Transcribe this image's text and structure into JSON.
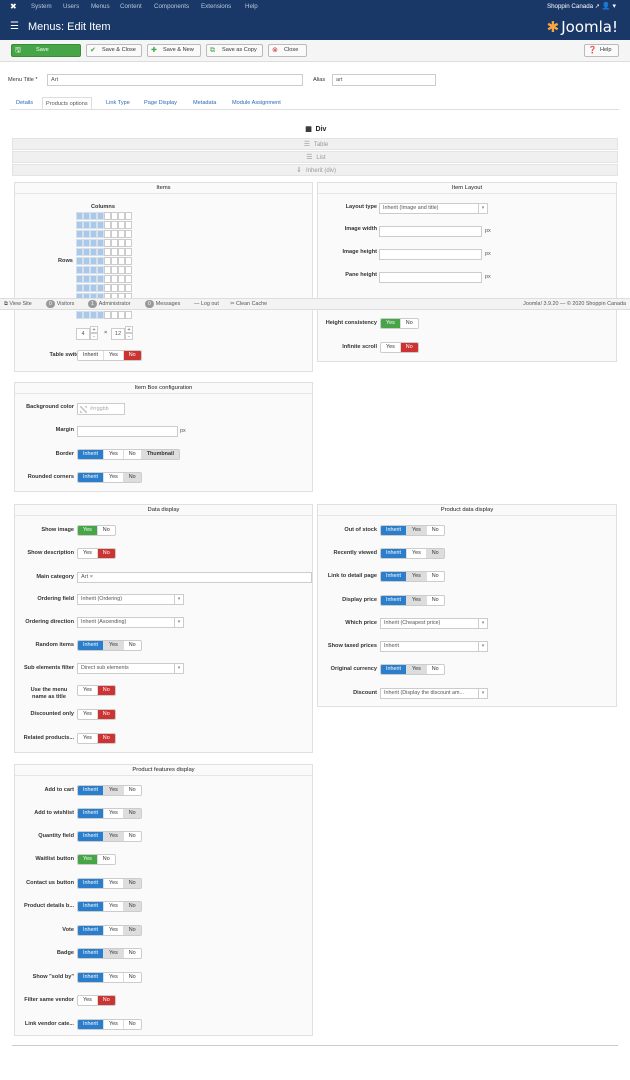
{
  "topnav": {
    "logo": "✖",
    "menu": [
      "System",
      "Users",
      "Menus",
      "Content",
      "Components",
      "Extensions",
      "Help"
    ],
    "site": "Shoppin Canada ↗",
    "user": "👤 ▾"
  },
  "header": {
    "title": "Menus: Edit Item",
    "brand": "Joomla!"
  },
  "toolbar": {
    "save": "Save",
    "save_close": "Save & Close",
    "save_new": "Save & New",
    "save_copy": "Save as Copy",
    "close": "Close",
    "help": "Help"
  },
  "form": {
    "menu_title_label": "Menu Title *",
    "menu_title_value": "Art",
    "alias_label": "Alias",
    "alias_value": "art"
  },
  "tabs": [
    "Details",
    "Products options",
    "Link Type",
    "Page Display",
    "Metadata",
    "Module Assignment"
  ],
  "layouts": [
    "Div",
    "Table",
    "List",
    "Inherit (div)"
  ],
  "items": {
    "title": "Items",
    "columns": "Columns",
    "rows": "Rows",
    "cols_value": "4",
    "rows_value": "12",
    "times": "×",
    "plus": "+",
    "minus": "-",
    "table_switcher": "Table switcher"
  },
  "item_layout": {
    "title": "Item Layout",
    "layout_type": "Layout type",
    "layout_value": "Inherit (Image and title)",
    "image_width": "Image width",
    "image_height": "Image height",
    "pane_height": "Pane height",
    "px": "px",
    "height_consistency": "Height consistency",
    "infinite_scroll": "Infinite scroll"
  },
  "statusbar": {
    "view_site": "View Site",
    "visitors": "Visitors",
    "visitors_n": "0",
    "admin": "Administrator",
    "admin_n": "1",
    "messages": "Messages",
    "messages_n": "0",
    "logout": "Log out",
    "clean_cache": "Clean Cache",
    "version": "Joomla! 3.9.20 — © 2020 Shoppin Canada"
  },
  "itembox": {
    "title": "Item Box configuration",
    "background_color": "Background color",
    "color_placeholder": "#rrggbb",
    "margin": "Margin",
    "px": "px",
    "border": "Border",
    "rounded": "Rounded corners"
  },
  "data_display": {
    "title": "Data display",
    "show_image": "Show image",
    "show_description": "Show description",
    "main_category": "Main category",
    "main_category_value": "Art ×",
    "ordering_field": "Ordering field",
    "ordering_field_value": "Inherit (Ordering)",
    "ordering_direction": "Ordering direction",
    "ordering_direction_value": "Inherit (Ascending)",
    "random_items": "Random items",
    "sub_elements_filter": "Sub elements filter",
    "sub_elements_value": "Direct sub elements",
    "use_menu_name": "Use the menu name as title",
    "discounted_only": "Discounted only",
    "related_products": "Related products..."
  },
  "product_data": {
    "title": "Product data display",
    "out_of_stock": "Out of stock",
    "recently_viewed": "Recently viewed",
    "link_to_detail": "Link to detail page",
    "display_price": "Display price",
    "which_price": "Which price",
    "which_price_value": "Inherit (Cheapest price)",
    "show_taxed": "Show taxed prices",
    "show_taxed_value": "Inherit",
    "original_currency": "Original currency",
    "discount": "Discount",
    "discount_value": "Inherit (Display the discount am..."
  },
  "features": {
    "title": "Product features display",
    "add_to_cart": "Add to cart",
    "add_to_wishlist": "Add to wishlist",
    "quantity_field": "Quantity field",
    "waitlist_button": "Waitlist button",
    "contact_us": "Contact us button",
    "product_details": "Product details b...",
    "vote": "Vote",
    "badge": "Badge",
    "show_sold_by": "Show \"sold by\"",
    "filter_same_vendor": "Filter same vendor",
    "link_vendor": "Link vendor cate..."
  },
  "opts": {
    "inherit": "Inherit",
    "yes": "Yes",
    "no": "No",
    "thumbnail": "Thumbnail"
  }
}
